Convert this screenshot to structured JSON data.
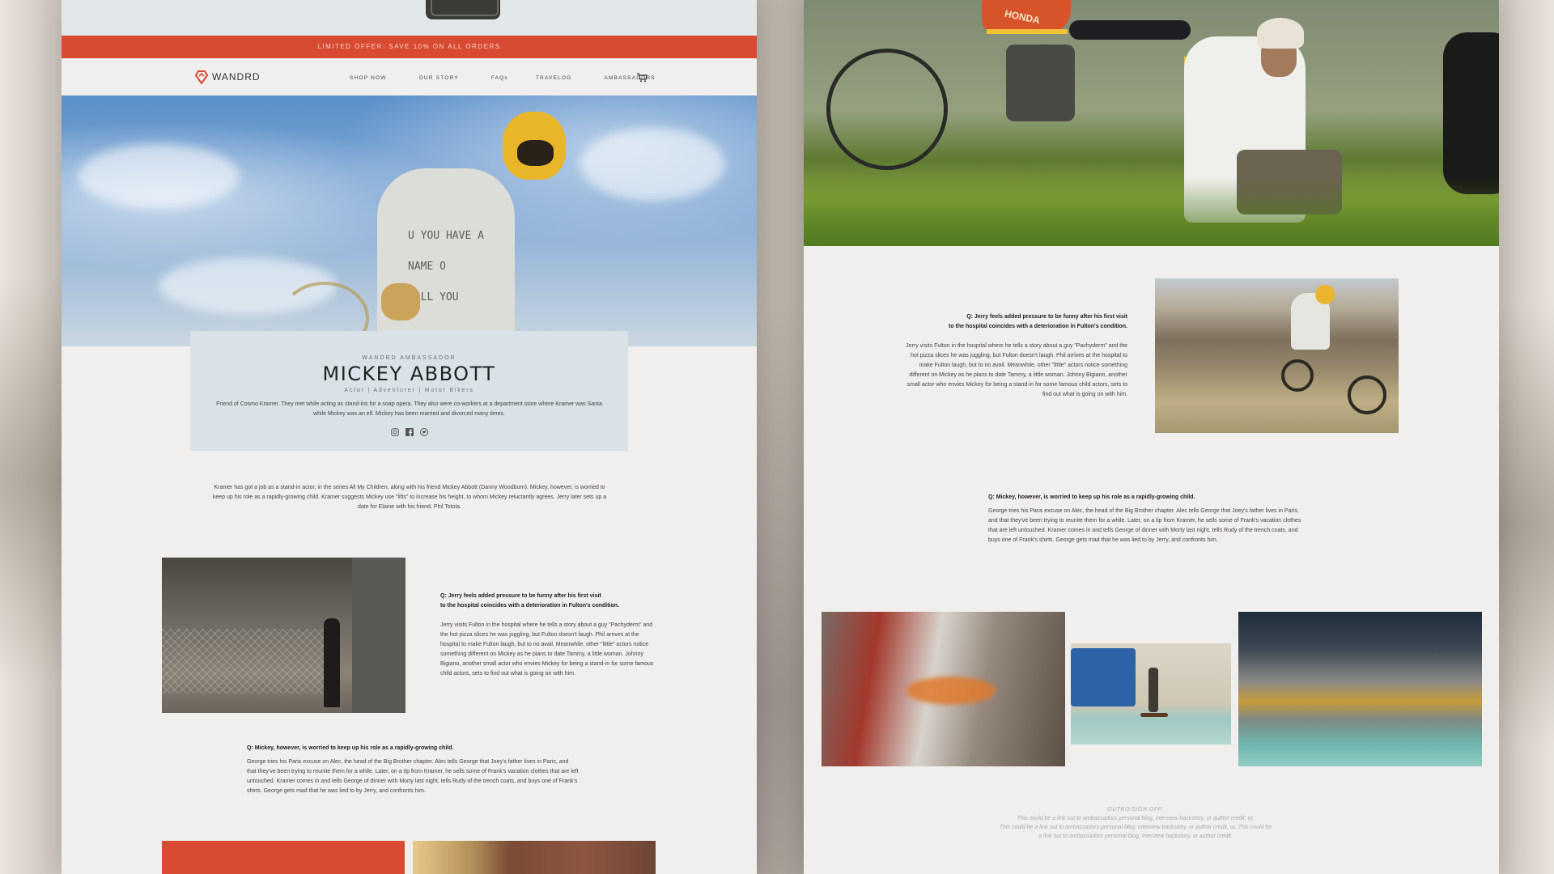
{
  "top_offer": "LIMITED OFFER: SAVE 10% ON ALL ORDERS",
  "brand": {
    "name": "WANDRD",
    "accent": "#d94a32"
  },
  "nav": {
    "items": [
      "SHOP NOW",
      "OUR STORY",
      "FAQs",
      "TRAVELOG",
      "AMBASSADORS"
    ],
    "cart_icon": "cart-icon"
  },
  "hero": {
    "shirt_text": [
      "U YOU HAVE A",
      "NAME O",
      "CALL YOU"
    ]
  },
  "profile": {
    "eyebrow": "WANDRD AMBASSADOR",
    "name": "MICKEY ABBOTT",
    "roles": "Actor | Adventurer | Motor Bikers",
    "bio": "Friend of Cosmo Kramer. They met while acting as stand-ins for a soap opera. They also were co-workers at a department store where Kramer was Santa while Mickey was an elf. Mickey has been married and divorced many times.",
    "social": [
      "instagram-icon",
      "facebook-icon",
      "twitter-icon"
    ]
  },
  "intro": "Kramer has got a job as a stand-in actor, in the series All My Children, along with his friend Mickey Abbott (Danny Woodburn). Mickey, however, is worried to keep up his role as a rapidly-growing child. Kramer suggests Mickey use \"lifts\" to increase his height, to whom Mickey reluctantly agrees. Jerry later sets up a date for Elaine with his friend, Phil Totola.",
  "qa1": {
    "question_line1": "Q: Jerry feels added pressure to be funny after his first visit",
    "question_line2": "to the hospital coincides with a deterioration in Fulton's condition.",
    "answer": "Jerry visits Fulton in the hospital where he tells a story about a guy \"Pachyderm\" and the hot pizza slices he was juggling, but Fulton doesn't laugh. Phil arrives at the hospital to make Fulton laugh, but to no avail. Meanwhile, other \"little\" actors notice something different on Mickey as he plans to date Tammy, a little woman. Johnny Bigiano, another small actor who envies Mickey for being a stand-in for some famous child actors, sets to find out what is going on with him."
  },
  "qa2": {
    "question": "Q: Mickey, however, is worried to keep up his role as a rapidly-growing child.",
    "answer": "George tries his Paris excuse on Alec, the head of the Big Brother chapter. Alec tells George that Joey's father lives in Paris, and that they've been trying to reunite them for a while. Later, on a tip from Kramer, he sells some of Frank's vacation clothes that are left untouched. Kramer comes in and tells George of dinner with Morty last night, tells Rudy of the trench coats, and buys one of Frank's shirts. George gets mad that he was lied to by Jerry, and confronts him."
  },
  "moto_photo": {
    "tank_brand": "HONDA"
  },
  "outro": {
    "title": "OUTRO/SIGN OFF:",
    "line1": "This could be a link out to ambassadors personal blog, interview backstory, or author credit, or,",
    "line2": "This could be a link out to ambassadors personal blog, interview backstory, or author credit, or, This could be",
    "line3": "a link out to ambassadors personal blog, interview backstory, or author credit."
  }
}
